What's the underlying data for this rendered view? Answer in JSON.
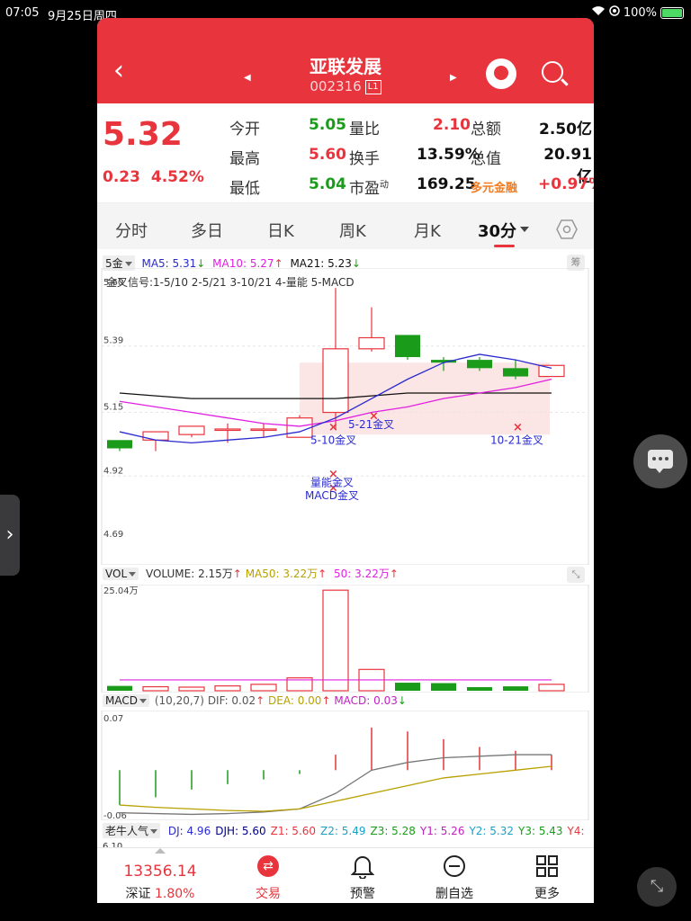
{
  "status": {
    "time": "07:05",
    "date": "9月25日周四",
    "battery": "100%"
  },
  "header": {
    "title": "亚联发展",
    "code": "002316",
    "badge": "L1"
  },
  "quote": {
    "price": "5.32",
    "change": "0.23",
    "change_pct": "4.52%",
    "rows": [
      [
        {
          "label": "今开",
          "value": "5.05",
          "color": "green"
        },
        {
          "label": "量比",
          "value": "2.10",
          "color": "red"
        },
        {
          "label": "总额",
          "value": "2.50亿",
          "color": "dark"
        }
      ],
      [
        {
          "label": "最高",
          "value": "5.60",
          "color": "red"
        },
        {
          "label": "换手",
          "value": "13.59%",
          "color": "dark"
        },
        {
          "label": "总值",
          "value": "20.91亿",
          "color": "dark"
        }
      ],
      [
        {
          "label": "最低",
          "value": "5.04",
          "color": "green"
        },
        {
          "label": "市盈",
          "label_sup": "动",
          "value": "169.25",
          "color": "dark"
        },
        {
          "label": "多元金融",
          "value": "+0.97%",
          "color": "red",
          "label_color": "orange"
        }
      ]
    ]
  },
  "tabs": [
    "分时",
    "多日",
    "日K",
    "周K",
    "月K",
    "30分"
  ],
  "active_tab": "30分",
  "kline": {
    "indicator": "5金",
    "ma5": "MA5: 5.31",
    "ma10": "MA10: 5.27",
    "ma21": "MA21: 5.23",
    "signal_text": "金叉信号:1-5/10 2-5/21 3-10/21 4-量能 5-MACD",
    "chip_label": "筹",
    "axis": [
      "5.39",
      "5.15",
      "4.92",
      "4.69"
    ],
    "axis_top": "5.60",
    "annotations": [
      "5-21金叉",
      "5-10金叉",
      "10-21金叉",
      "量能金叉",
      "MACD金叉"
    ],
    "candles": [
      {
        "o": 5.05,
        "c": 5.02,
        "h": 5.05,
        "l": 5.01
      },
      {
        "o": 5.05,
        "c": 5.08,
        "h": 5.08,
        "l": 5.01
      },
      {
        "o": 5.07,
        "c": 5.1,
        "h": 5.1,
        "l": 5.06
      },
      {
        "o": 5.09,
        "c": 5.09,
        "h": 5.11,
        "l": 5.04
      },
      {
        "o": 5.09,
        "c": 5.09,
        "h": 5.11,
        "l": 5.06
      },
      {
        "o": 5.06,
        "c": 5.13,
        "h": 5.14,
        "l": 5.06
      },
      {
        "o": 5.15,
        "c": 5.38,
        "h": 5.6,
        "l": 5.09
      },
      {
        "o": 5.38,
        "c": 5.42,
        "h": 5.53,
        "l": 5.37
      },
      {
        "o": 5.43,
        "c": 5.35,
        "h": 5.43,
        "l": 5.34
      },
      {
        "o": 5.34,
        "c": 5.33,
        "h": 5.35,
        "l": 5.3
      },
      {
        "o": 5.34,
        "c": 5.31,
        "h": 5.35,
        "l": 5.3
      },
      {
        "o": 5.31,
        "c": 5.28,
        "h": 5.34,
        "l": 5.27
      },
      {
        "o": 5.28,
        "c": 5.32,
        "h": 5.32,
        "l": 5.28
      }
    ],
    "ma5_vals": [
      5.08,
      5.05,
      5.04,
      5.05,
      5.06,
      5.08,
      5.13,
      5.2,
      5.27,
      5.33,
      5.36,
      5.34,
      5.31
    ],
    "ma10_vals": [
      5.19,
      5.17,
      5.15,
      5.13,
      5.11,
      5.1,
      5.12,
      5.15,
      5.17,
      5.2,
      5.22,
      5.24,
      5.27
    ],
    "ma21_vals": [
      5.22,
      5.21,
      5.2,
      5.2,
      5.2,
      5.2,
      5.2,
      5.21,
      5.22,
      5.22,
      5.22,
      5.22,
      5.22
    ]
  },
  "volume": {
    "indicator": "VOL",
    "volume": "VOLUME: 2.15万",
    "ma50": "MA50: 3.22万",
    "v50": "50: 3.22万",
    "axis_top": "25.04万",
    "values": [
      1.2,
      1.0,
      0.9,
      1.2,
      1.6,
      3.2,
      25.0,
      5.3,
      2.0,
      1.9,
      0.9,
      1.1,
      1.6
    ],
    "ma": 2.7
  },
  "macd": {
    "indicator": "MACD",
    "params": "(10,20,7)",
    "dif": "DIF: 0.02",
    "dea": "DEA: 0.00",
    "macd": "MACD: 0.03",
    "axis_top": "0.07",
    "axis_bottom": "-0.06",
    "hist": [
      -0.045,
      -0.035,
      -0.025,
      -0.018,
      -0.012,
      -0.005,
      0.02,
      0.055,
      0.05,
      0.04,
      0.03,
      0.025,
      0.02
    ],
    "dif_vals": [
      -0.055,
      -0.056,
      -0.057,
      -0.056,
      -0.054,
      -0.05,
      -0.03,
      0.0,
      0.01,
      0.016,
      0.018,
      0.02,
      0.02
    ],
    "dea_vals": [
      -0.045,
      -0.048,
      -0.05,
      -0.052,
      -0.053,
      -0.05,
      -0.04,
      -0.03,
      -0.02,
      -0.01,
      -0.005,
      0.0,
      0.005
    ]
  },
  "popularity": {
    "indicator": "老牛人气",
    "items": [
      {
        "text": "DJ: 4.96",
        "color": "#2a2ad0"
      },
      {
        "text": "DJH: 5.60",
        "color": "#000088"
      },
      {
        "text": "Z1: 5.60",
        "color": "#e8343c"
      },
      {
        "text": "Z2: 5.49",
        "color": "#1aa0c8"
      },
      {
        "text": "Z3: 5.28",
        "color": "#1a9c1a"
      },
      {
        "text": "Y1: 5.26",
        "color": "#c020c0"
      },
      {
        "text": "Y2: 5.32",
        "color": "#1aa0c8"
      },
      {
        "text": "Y3: 5.43",
        "color": "#1a9c1a"
      },
      {
        "text": "Y4:",
        "color": "#e8343c"
      }
    ],
    "axis_top": "6.10"
  },
  "bottom": {
    "index_value": "13356.14",
    "index_name": "深证",
    "index_pct": "1.80%",
    "nav": [
      "交易",
      "预警",
      "删自选",
      "更多"
    ]
  },
  "colors": {
    "red": "#e8343c",
    "green": "#1a9c1a",
    "ma5": "#2a2ad0",
    "ma10": "#e020e0",
    "ma21": "#111111"
  }
}
